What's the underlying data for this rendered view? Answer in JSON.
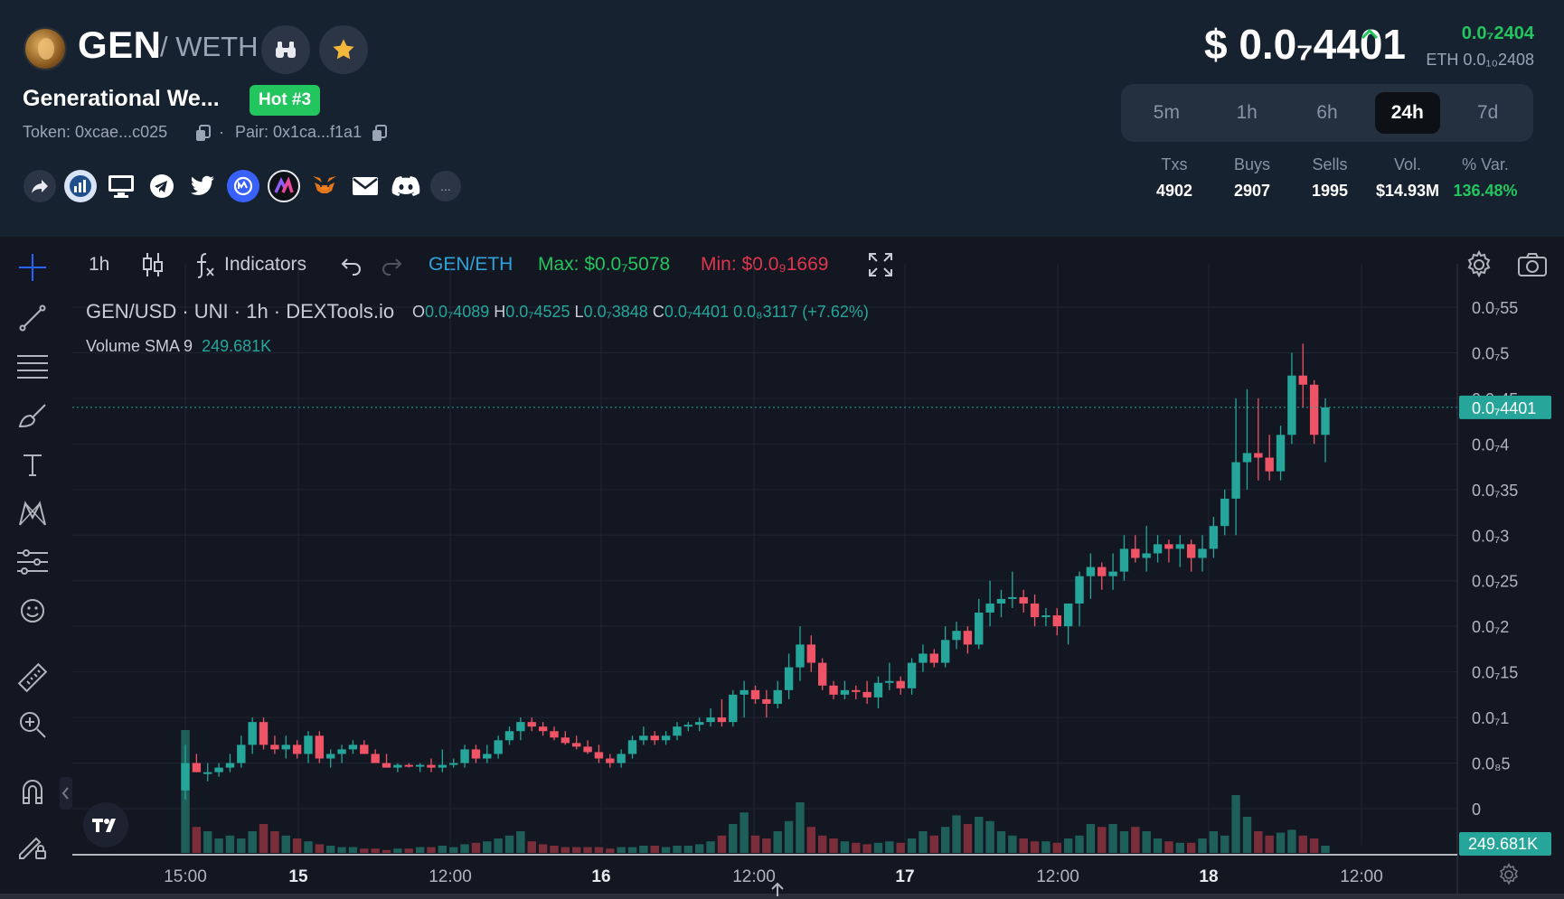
{
  "header": {
    "pair": {
      "base": "GEN",
      "quote": "/ WETH"
    },
    "token_name": "Generational We...",
    "hot_badge": "Hot #3",
    "token_addr": "Token: 0xcae...c025",
    "pair_addr": "Pair: 0x1ca...f1a1",
    "separator": "·",
    "more_label": "...",
    "price": "$ 0.0₇4401",
    "price_change": "0.0₇2404",
    "price_eth": "ETH 0.0₁₀2408",
    "socials": [
      "share-icon",
      "dextools-icon",
      "website-icon",
      "telegram-icon",
      "twitter-icon",
      "coinmarketcap-icon",
      "nomics-icon",
      "metamask-icon",
      "email-icon",
      "discord-icon"
    ]
  },
  "timeframes": {
    "items": [
      "5m",
      "1h",
      "6h",
      "24h",
      "7d"
    ],
    "active": "24h"
  },
  "stats": {
    "labels": [
      "Txs",
      "Buys",
      "Sells",
      "Vol.",
      "% Var."
    ],
    "values": [
      "4902",
      "2907",
      "1995",
      "$14.93M",
      "136.48%"
    ]
  },
  "toolbar": {
    "interval": "1h",
    "indicators": "Indicators",
    "pair_link": "GEN/ETH",
    "max": "Max: $0.0₇5078",
    "min": "Min: $0.0₉1669"
  },
  "legend": {
    "title": "GEN/USD · UNI · 1h · DEXTools.io",
    "ohlc": {
      "o": "0.0₇4089",
      "h": "0.0₇4525",
      "l": "0.0₇3848",
      "c": "0.0₇4401",
      "change": "0.0₈3117 (+7.62%)"
    },
    "volume_label": "Volume SMA 9",
    "volume_value": "249.681K"
  },
  "chart_data": {
    "type": "candlestick",
    "y_ticks": [
      "0.0₇55",
      "0.0₇5",
      "0.0₇45",
      "0.0₇4",
      "0.0₇35",
      "0.0₇3",
      "0.0₇25",
      "0.0₇2",
      "0.0₇15",
      "0.0₇1",
      "0.0₈5",
      "0"
    ],
    "y_values": [
      0.55,
      0.5,
      0.45,
      0.4,
      0.35,
      0.3,
      0.25,
      0.2,
      0.15,
      0.1,
      0.05,
      0
    ],
    "y_unit": "× 1e-7 USD",
    "ylim": [
      0,
      0.55
    ],
    "current_price_label": "0.0₇4401",
    "current_price": 0.4401,
    "volume_label": "249.681K",
    "x_ticks": [
      "15:00",
      "15",
      "12:00",
      "16",
      "12:00",
      "17",
      "12:00",
      "18",
      "12:00"
    ],
    "x_tick_bold": [
      false,
      true,
      false,
      true,
      false,
      true,
      false,
      true,
      false
    ],
    "candles": [
      [
        0.02,
        0.07,
        0.01,
        0.05
      ],
      [
        0.05,
        0.06,
        0.04,
        0.04
      ],
      [
        0.04,
        0.05,
        0.03,
        0.04
      ],
      [
        0.04,
        0.05,
        0.035,
        0.045
      ],
      [
        0.045,
        0.06,
        0.04,
        0.05
      ],
      [
        0.05,
        0.08,
        0.045,
        0.07
      ],
      [
        0.07,
        0.1,
        0.06,
        0.095
      ],
      [
        0.095,
        0.1,
        0.065,
        0.07
      ],
      [
        0.07,
        0.08,
        0.06,
        0.065
      ],
      [
        0.065,
        0.08,
        0.055,
        0.07
      ],
      [
        0.07,
        0.075,
        0.055,
        0.06
      ],
      [
        0.06,
        0.085,
        0.05,
        0.08
      ],
      [
        0.08,
        0.085,
        0.05,
        0.055
      ],
      [
        0.055,
        0.065,
        0.045,
        0.06
      ],
      [
        0.06,
        0.07,
        0.05,
        0.065
      ],
      [
        0.065,
        0.075,
        0.06,
        0.07
      ],
      [
        0.07,
        0.075,
        0.06,
        0.06
      ],
      [
        0.06,
        0.065,
        0.05,
        0.05
      ],
      [
        0.05,
        0.06,
        0.045,
        0.045
      ],
      [
        0.045,
        0.05,
        0.04,
        0.048
      ],
      [
        0.048,
        0.05,
        0.045,
        0.046
      ],
      [
        0.046,
        0.05,
        0.04,
        0.048
      ],
      [
        0.048,
        0.055,
        0.04,
        0.045
      ],
      [
        0.045,
        0.065,
        0.04,
        0.048
      ],
      [
        0.048,
        0.055,
        0.045,
        0.05
      ],
      [
        0.05,
        0.07,
        0.045,
        0.065
      ],
      [
        0.065,
        0.07,
        0.05,
        0.055
      ],
      [
        0.055,
        0.07,
        0.05,
        0.06
      ],
      [
        0.06,
        0.08,
        0.055,
        0.075
      ],
      [
        0.075,
        0.09,
        0.07,
        0.085
      ],
      [
        0.085,
        0.1,
        0.075,
        0.095
      ],
      [
        0.095,
        0.1,
        0.085,
        0.09
      ],
      [
        0.09,
        0.095,
        0.08,
        0.085
      ],
      [
        0.085,
        0.09,
        0.075,
        0.078
      ],
      [
        0.078,
        0.085,
        0.07,
        0.072
      ],
      [
        0.072,
        0.08,
        0.065,
        0.068
      ],
      [
        0.068,
        0.075,
        0.06,
        0.062
      ],
      [
        0.062,
        0.07,
        0.05,
        0.055
      ],
      [
        0.055,
        0.06,
        0.045,
        0.05
      ],
      [
        0.05,
        0.065,
        0.045,
        0.06
      ],
      [
        0.06,
        0.08,
        0.055,
        0.075
      ],
      [
        0.075,
        0.09,
        0.07,
        0.08
      ],
      [
        0.08,
        0.085,
        0.07,
        0.075
      ],
      [
        0.075,
        0.085,
        0.07,
        0.08
      ],
      [
        0.08,
        0.095,
        0.075,
        0.09
      ],
      [
        0.09,
        0.095,
        0.085,
        0.092
      ],
      [
        0.092,
        0.1,
        0.085,
        0.095
      ],
      [
        0.095,
        0.11,
        0.09,
        0.1
      ],
      [
        0.1,
        0.12,
        0.09,
        0.095
      ],
      [
        0.095,
        0.13,
        0.09,
        0.125
      ],
      [
        0.125,
        0.14,
        0.1,
        0.13
      ],
      [
        0.13,
        0.135,
        0.115,
        0.12
      ],
      [
        0.12,
        0.13,
        0.1,
        0.115
      ],
      [
        0.115,
        0.14,
        0.11,
        0.13
      ],
      [
        0.13,
        0.17,
        0.12,
        0.155
      ],
      [
        0.155,
        0.2,
        0.14,
        0.18
      ],
      [
        0.18,
        0.19,
        0.15,
        0.16
      ],
      [
        0.16,
        0.165,
        0.13,
        0.135
      ],
      [
        0.135,
        0.14,
        0.12,
        0.125
      ],
      [
        0.125,
        0.14,
        0.12,
        0.13
      ],
      [
        0.13,
        0.135,
        0.12,
        0.128
      ],
      [
        0.128,
        0.14,
        0.115,
        0.122
      ],
      [
        0.122,
        0.145,
        0.11,
        0.138
      ],
      [
        0.138,
        0.16,
        0.13,
        0.14
      ],
      [
        0.14,
        0.145,
        0.125,
        0.132
      ],
      [
        0.132,
        0.165,
        0.125,
        0.16
      ],
      [
        0.16,
        0.18,
        0.15,
        0.17
      ],
      [
        0.17,
        0.175,
        0.155,
        0.16
      ],
      [
        0.16,
        0.2,
        0.155,
        0.185
      ],
      [
        0.185,
        0.205,
        0.175,
        0.195
      ],
      [
        0.195,
        0.2,
        0.17,
        0.18
      ],
      [
        0.18,
        0.23,
        0.175,
        0.215
      ],
      [
        0.215,
        0.25,
        0.2,
        0.225
      ],
      [
        0.225,
        0.24,
        0.21,
        0.23
      ],
      [
        0.23,
        0.26,
        0.22,
        0.232
      ],
      [
        0.232,
        0.24,
        0.215,
        0.225
      ],
      [
        0.225,
        0.235,
        0.2,
        0.21
      ],
      [
        0.21,
        0.22,
        0.2,
        0.212
      ],
      [
        0.212,
        0.22,
        0.19,
        0.2
      ],
      [
        0.2,
        0.22,
        0.18,
        0.225
      ],
      [
        0.225,
        0.26,
        0.2,
        0.255
      ],
      [
        0.255,
        0.28,
        0.23,
        0.265
      ],
      [
        0.265,
        0.27,
        0.24,
        0.255
      ],
      [
        0.255,
        0.28,
        0.24,
        0.26
      ],
      [
        0.26,
        0.3,
        0.25,
        0.285
      ],
      [
        0.285,
        0.3,
        0.27,
        0.275
      ],
      [
        0.275,
        0.31,
        0.26,
        0.28
      ],
      [
        0.28,
        0.3,
        0.27,
        0.29
      ],
      [
        0.29,
        0.295,
        0.27,
        0.285
      ],
      [
        0.285,
        0.3,
        0.265,
        0.29
      ],
      [
        0.29,
        0.295,
        0.26,
        0.275
      ],
      [
        0.275,
        0.3,
        0.26,
        0.285
      ],
      [
        0.285,
        0.32,
        0.275,
        0.31
      ],
      [
        0.31,
        0.35,
        0.3,
        0.34
      ],
      [
        0.34,
        0.45,
        0.3,
        0.38
      ],
      [
        0.38,
        0.46,
        0.35,
        0.39
      ],
      [
        0.39,
        0.45,
        0.36,
        0.385
      ],
      [
        0.385,
        0.41,
        0.36,
        0.37
      ],
      [
        0.37,
        0.42,
        0.36,
        0.41
      ],
      [
        0.41,
        0.5,
        0.4,
        0.475
      ],
      [
        0.475,
        0.51,
        0.44,
        0.465
      ],
      [
        0.465,
        0.47,
        0.4,
        0.41
      ],
      [
        0.41,
        0.45,
        0.38,
        0.4401
      ]
    ],
    "volumes": [
      0.85,
      0.18,
      0.15,
      0.1,
      0.12,
      0.1,
      0.15,
      0.2,
      0.15,
      0.12,
      0.1,
      0.08,
      0.06,
      0.05,
      0.04,
      0.04,
      0.03,
      0.03,
      0.02,
      0.03,
      0.03,
      0.04,
      0.04,
      0.05,
      0.04,
      0.06,
      0.07,
      0.08,
      0.1,
      0.12,
      0.15,
      0.08,
      0.06,
      0.05,
      0.04,
      0.04,
      0.04,
      0.04,
      0.03,
      0.04,
      0.04,
      0.05,
      0.05,
      0.04,
      0.05,
      0.05,
      0.06,
      0.08,
      0.12,
      0.2,
      0.28,
      0.12,
      0.1,
      0.15,
      0.22,
      0.35,
      0.18,
      0.12,
      0.1,
      0.08,
      0.07,
      0.06,
      0.07,
      0.08,
      0.07,
      0.1,
      0.15,
      0.12,
      0.18,
      0.26,
      0.2,
      0.25,
      0.22,
      0.15,
      0.12,
      0.1,
      0.08,
      0.08,
      0.07,
      0.1,
      0.12,
      0.2,
      0.18,
      0.2,
      0.15,
      0.18,
      0.15,
      0.1,
      0.08,
      0.07,
      0.07,
      0.1,
      0.15,
      0.12,
      0.4,
      0.25,
      0.15,
      0.12,
      0.14,
      0.16,
      0.12,
      0.1,
      0.05
    ]
  }
}
